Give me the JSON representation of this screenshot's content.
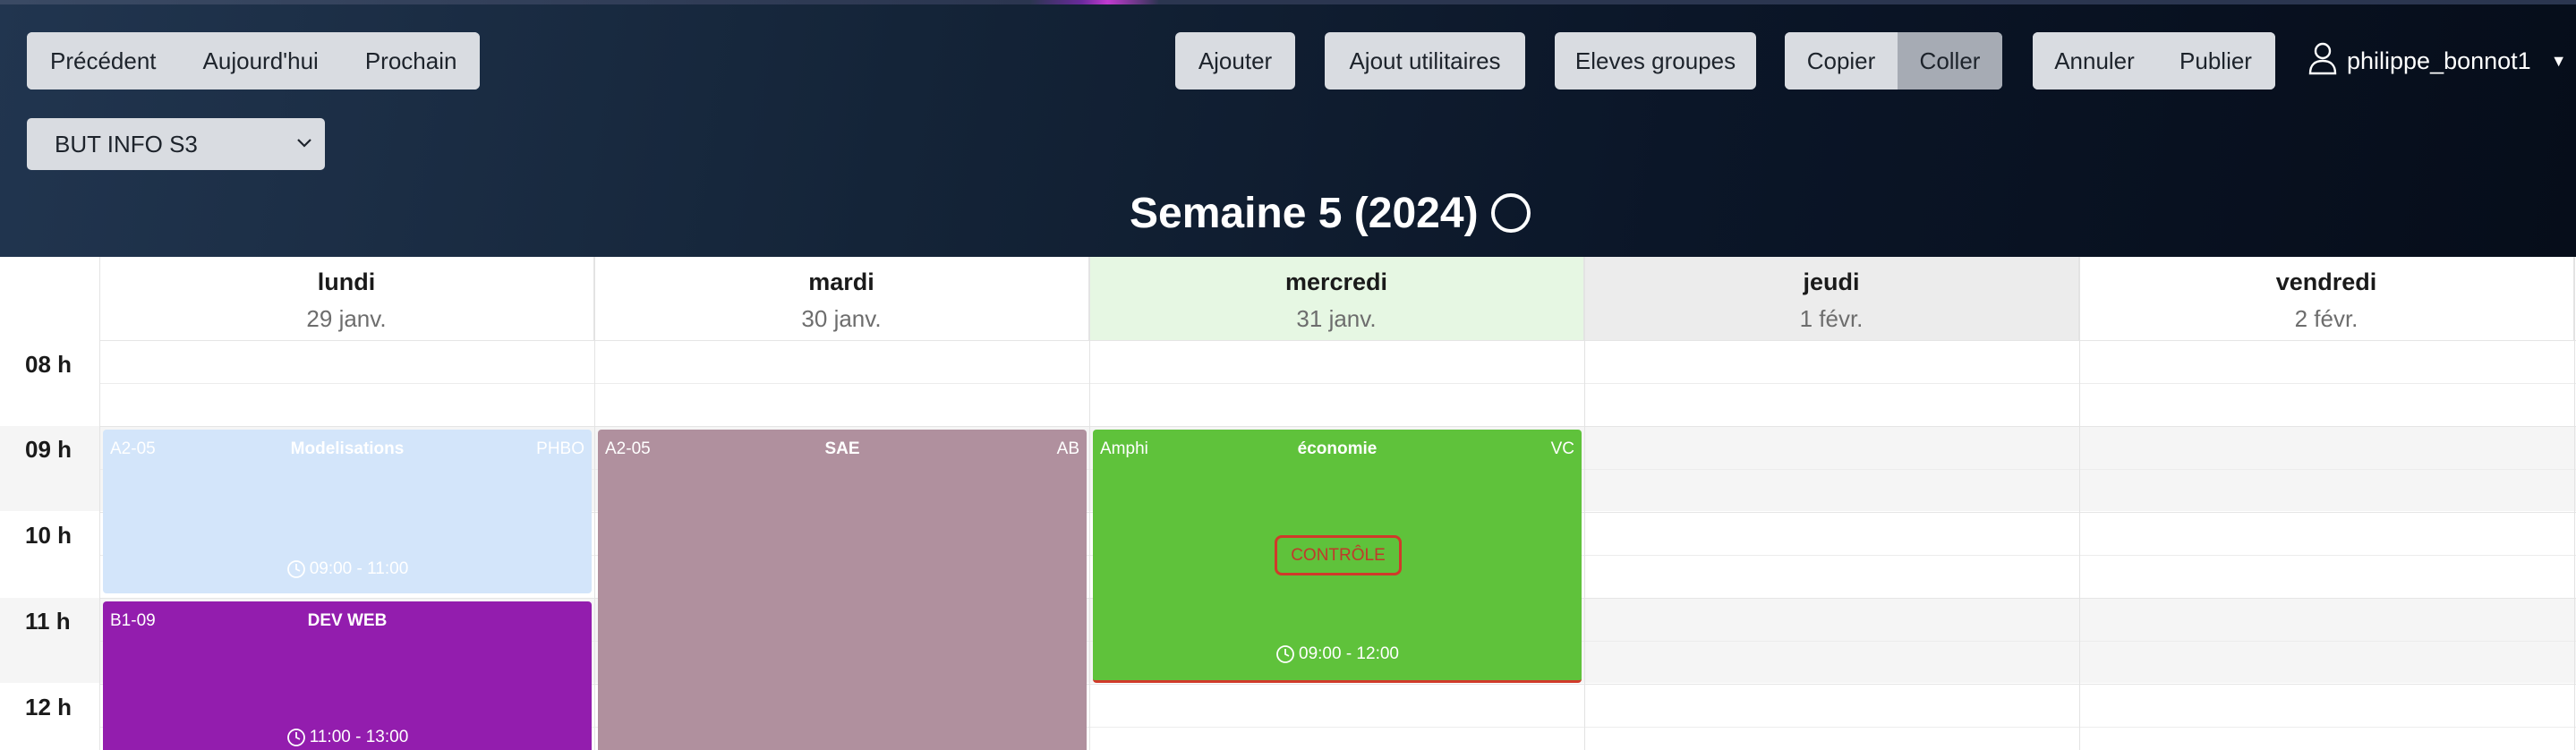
{
  "nav": {
    "previous": "Précédent",
    "today": "Aujourd'hui",
    "next": "Prochain"
  },
  "toolbar": {
    "add": "Ajouter",
    "add_utilities": "Ajout utilitaires",
    "student_groups": "Eleves groupes",
    "copy": "Copier",
    "paste": "Coller",
    "cancel": "Annuler",
    "publish": "Publier"
  },
  "user": {
    "name": "philippe_bonnot1",
    "icon": "user-icon"
  },
  "group_select": {
    "value": "BUT INFO S3"
  },
  "week": {
    "title": "Semaine 5 (2024)"
  },
  "days": [
    {
      "name": "lundi",
      "date": "29 janv."
    },
    {
      "name": "mardi",
      "date": "30 janv."
    },
    {
      "name": "mercredi",
      "date": "31 janv."
    },
    {
      "name": "jeudi",
      "date": "1 févr."
    },
    {
      "name": "vendredi",
      "date": "2 févr."
    }
  ],
  "hours": [
    "08 h",
    "09 h",
    "10 h",
    "11 h",
    "12 h"
  ],
  "events": [
    {
      "room": "A2-05",
      "title": "Modelisations",
      "teacher": "PHBO",
      "time": "09:00 - 11:00",
      "color": "#d3e5fa"
    },
    {
      "room": "B1-09",
      "title": "DEV WEB",
      "teacher": "",
      "time": "11:00 - 13:00",
      "color": "#931dae"
    },
    {
      "room": "A2-05",
      "title": "SAE",
      "teacher": "AB",
      "time": "",
      "color": "#b0909e"
    },
    {
      "room": "Amphi",
      "title": "économie",
      "teacher": "VC",
      "time": "09:00 - 12:00",
      "badge": "CONTRÔLE",
      "color": "#5fc23b"
    }
  ],
  "colors": {
    "today_column": "#e6f7e3",
    "selected_day": "#ececec",
    "control_border": "#d03a2a"
  }
}
